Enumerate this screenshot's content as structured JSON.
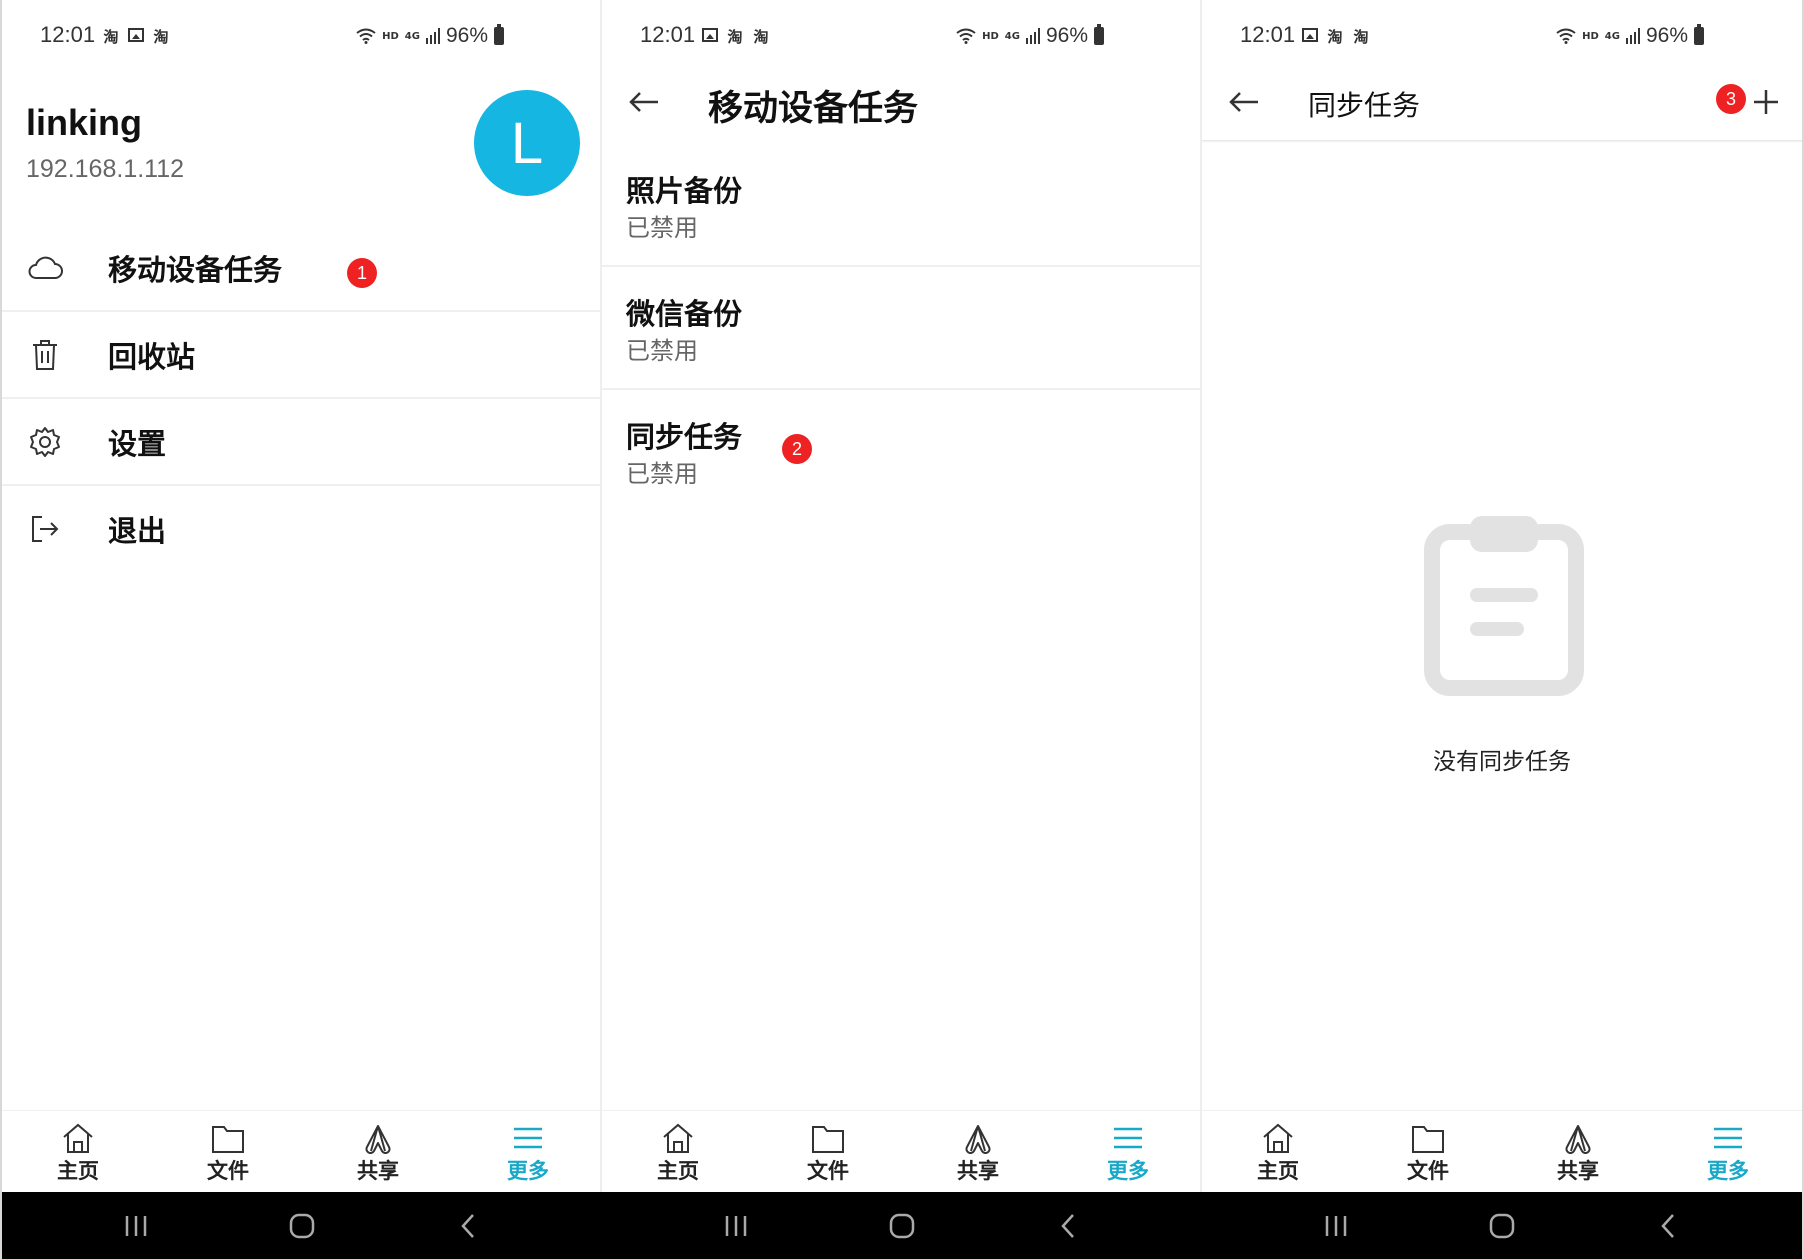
{
  "status_bar": {
    "time": "12:01",
    "notif_icon_1": "淘",
    "notif_icon_2": "淘",
    "battery": "96%",
    "network": "4G",
    "hd": "HD"
  },
  "panel1": {
    "account": {
      "name": "linking",
      "ip": "192.168.1.112",
      "avatar_letter": "L",
      "avatar_color": "#16b6e3"
    },
    "menu": [
      {
        "label": "移动设备任务",
        "icon": "cloud-icon"
      },
      {
        "label": "回收站",
        "icon": "trash-icon"
      },
      {
        "label": "设置",
        "icon": "gear-icon"
      },
      {
        "label": "退出",
        "icon": "logout-icon"
      }
    ],
    "badge": "1"
  },
  "panel2": {
    "title": "移动设备任务",
    "tasks": [
      {
        "name": "照片备份",
        "status": "已禁用"
      },
      {
        "name": "微信备份",
        "status": "已禁用"
      },
      {
        "name": "同步任务",
        "status": "已禁用"
      }
    ],
    "badge": "2"
  },
  "panel3": {
    "title": "同步任务",
    "empty_text": "没有同步任务",
    "badge": "3"
  },
  "bottom_nav": [
    {
      "label": "主页",
      "icon": "home-icon",
      "active": false
    },
    {
      "label": "文件",
      "icon": "folder-icon",
      "active": false
    },
    {
      "label": "共享",
      "icon": "share-icon",
      "active": false
    },
    {
      "label": "更多",
      "icon": "menu-icon",
      "active": true
    }
  ],
  "colors": {
    "accent": "#17a9c9",
    "badge": "#ee2222",
    "avatar": "#16b6e3"
  }
}
